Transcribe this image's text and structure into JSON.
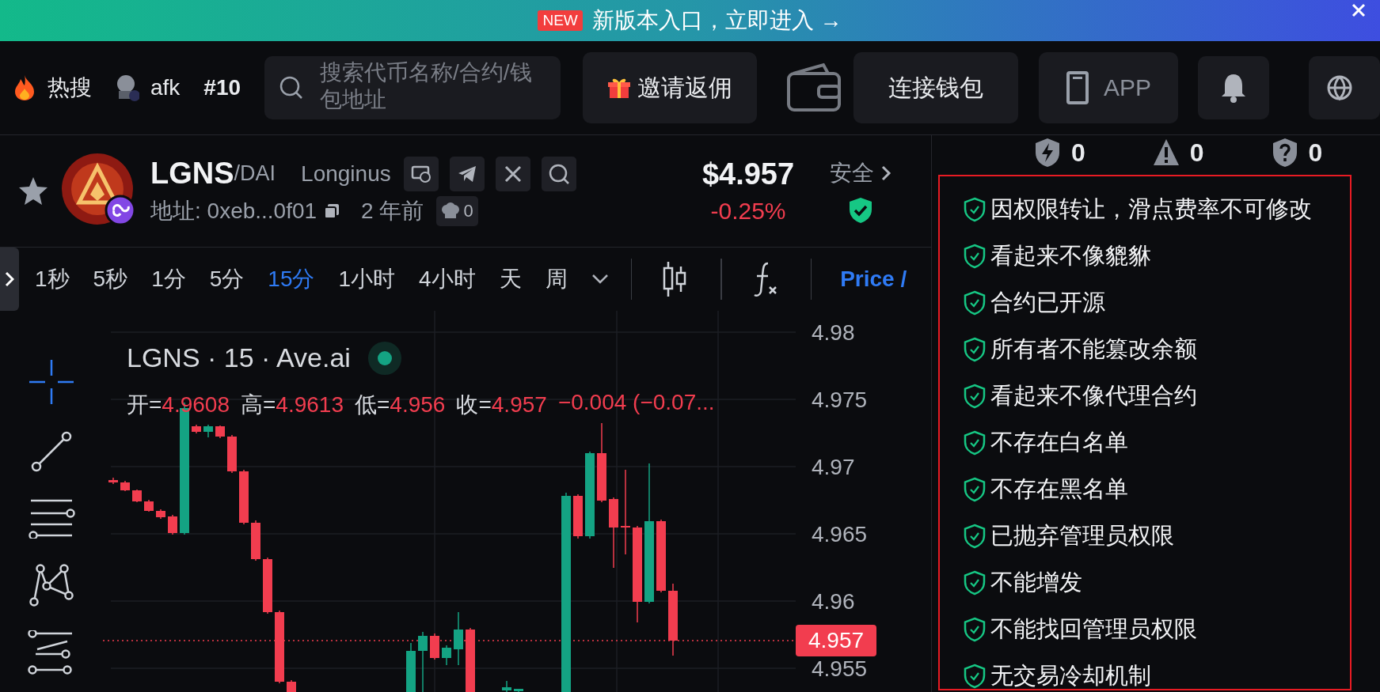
{
  "banner": {
    "badge": "NEW",
    "text": "新版本入口，立即进入 →"
  },
  "nav": {
    "hot": "热搜",
    "user": "afk",
    "rank": "#10",
    "search": {
      "placeholder": "搜索代币名称/合约/钱包地址"
    },
    "invite": "邀请返佣",
    "connect": "连接钱包",
    "app": "APP"
  },
  "token": {
    "symbol": "LGNS",
    "quote": "/DAI",
    "name": "Longinus",
    "address": "地址: 0xeb...0f01",
    "age": "2 年前",
    "chef_count": "0",
    "price": "$4.957",
    "change": "-0.25%",
    "safety": "安全"
  },
  "intervals": [
    {
      "label": "1秒",
      "selected": false
    },
    {
      "label": "5秒",
      "selected": false
    },
    {
      "label": "1分",
      "selected": false
    },
    {
      "label": "5分",
      "selected": false
    },
    {
      "label": "15分",
      "selected": true
    },
    {
      "label": "1小时",
      "selected": false
    },
    {
      "label": "4小时",
      "selected": false
    },
    {
      "label": "天",
      "selected": false
    },
    {
      "label": "周",
      "selected": false
    }
  ],
  "toolbar": {
    "price_label": "Price /"
  },
  "chart": {
    "legend": "LGNS · 15 · Ave.ai",
    "ohlc": [
      {
        "label": "开=",
        "value": "4.9608"
      },
      {
        "label": "高=",
        "value": "4.9613"
      },
      {
        "label": "低=",
        "value": "4.956"
      },
      {
        "label": "收=",
        "value": "4.957"
      }
    ],
    "change": "−0.004 (−0.07...",
    "price_axis": [
      "4.98",
      "4.975",
      "4.97",
      "4.965",
      "4.96",
      "4.955"
    ],
    "current_price": "4.957"
  },
  "risk_counts": [
    {
      "kind": "lightning",
      "count": "0"
    },
    {
      "kind": "warning",
      "count": "0"
    },
    {
      "kind": "question",
      "count": "0"
    }
  ],
  "checks": [
    "因权限转让，滑点费率不可修改",
    "看起来不像貔貅",
    "合约已开源",
    "所有者不能篡改余额",
    "看起来不像代理合约",
    "不存在白名单",
    "不存在黑名单",
    "已抛弃管理员权限",
    "不能增发",
    "不能找回管理员权限",
    "无交易冷却机制"
  ]
}
